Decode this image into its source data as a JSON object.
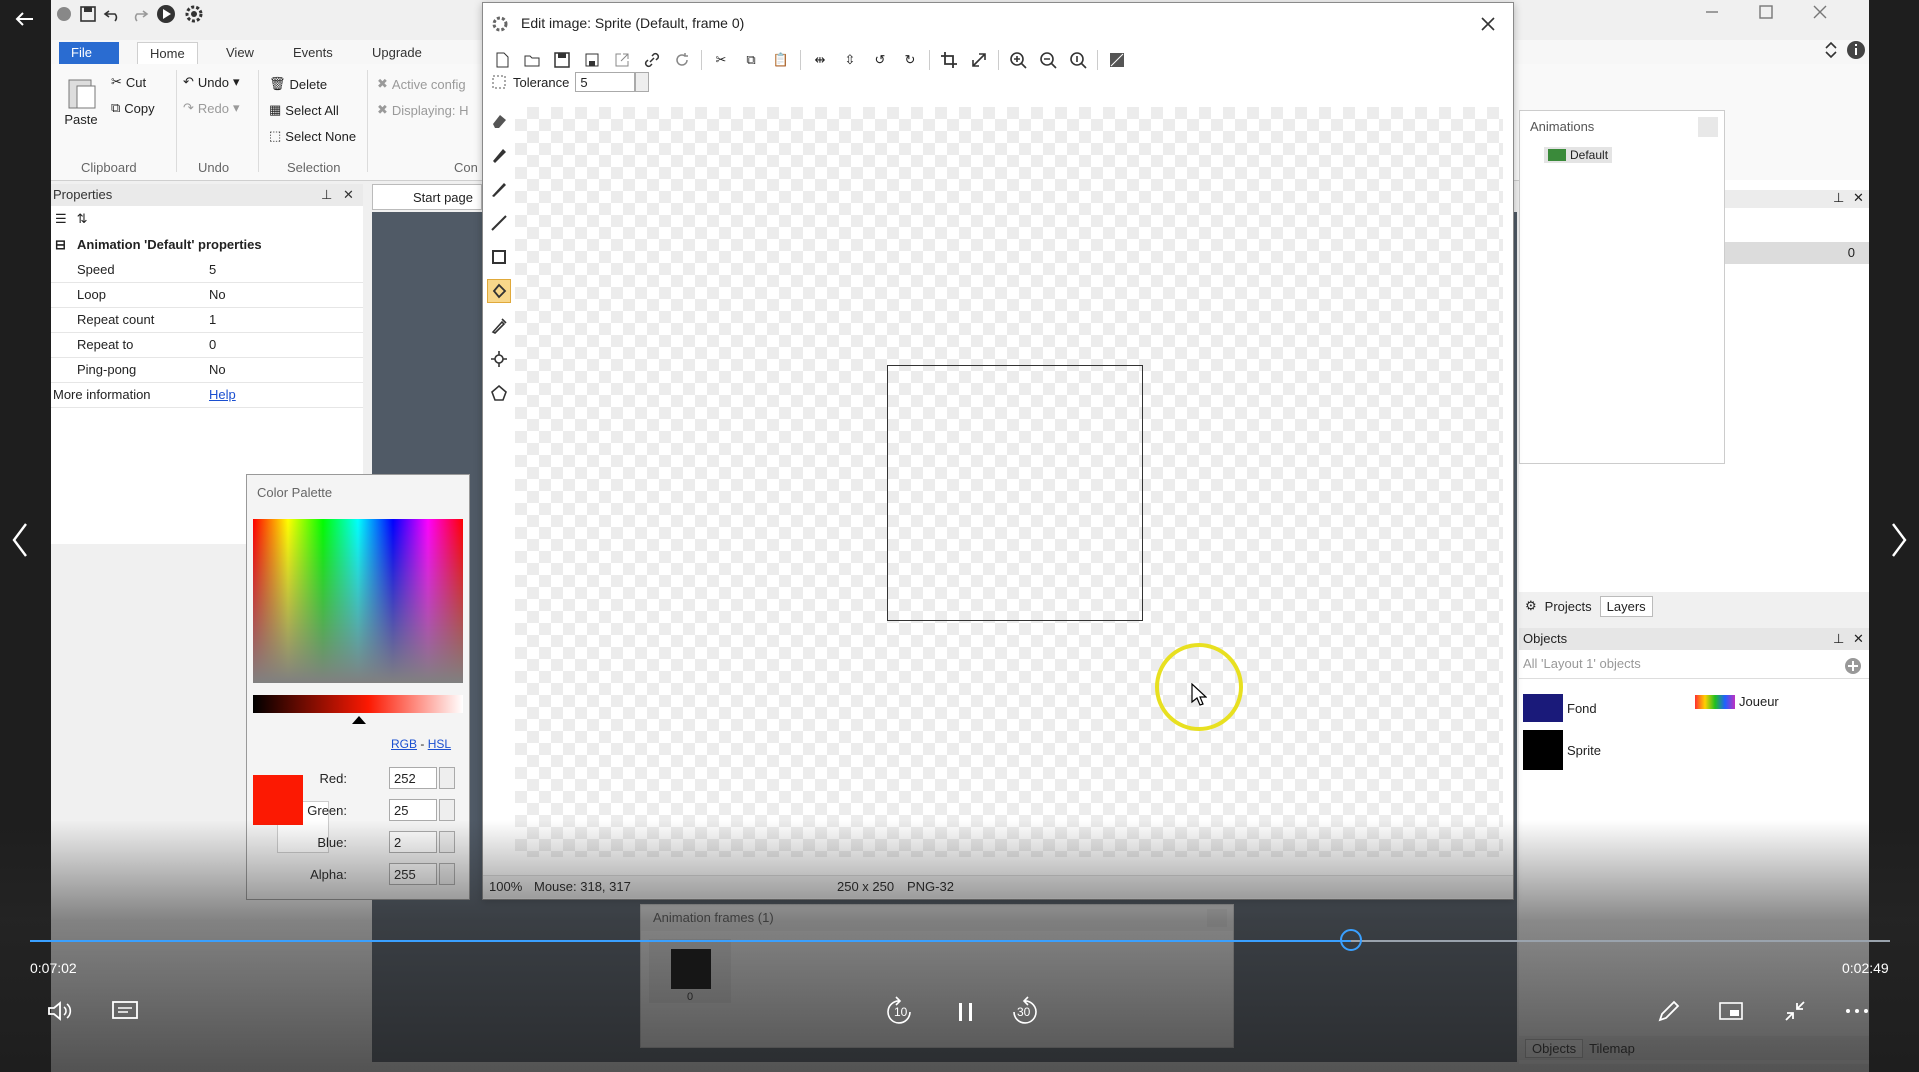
{
  "ribbon": {
    "tabs": [
      "File",
      "Home",
      "View",
      "Events",
      "Upgrade"
    ],
    "clipboard": {
      "paste": "Paste",
      "cut": "Cut",
      "copy": "Copy",
      "label": "Clipboard"
    },
    "undo": {
      "undo": "Undo",
      "redo": "Redo",
      "label": "Undo"
    },
    "selection": {
      "delete": "Delete",
      "select_all": "Select All",
      "select_none": "Select None",
      "label": "Selection"
    },
    "config": {
      "active": "Active config",
      "displaying": "Displaying: H",
      "label": "Con"
    }
  },
  "properties": {
    "title": "Properties",
    "section": "Animation 'Default' properties",
    "rows": [
      {
        "k": "Speed",
        "v": "5"
      },
      {
        "k": "Loop",
        "v": "No"
      },
      {
        "k": "Repeat count",
        "v": "1"
      },
      {
        "k": "Repeat to",
        "v": "0"
      },
      {
        "k": "Ping-pong",
        "v": "No"
      }
    ],
    "more_label": "More information",
    "more_link": "Help"
  },
  "center": {
    "start_tab": "Start page"
  },
  "dialog": {
    "title": "Edit image: Sprite (Default, frame 0)",
    "tolerance_label": "Tolerance",
    "tolerance_value": "5",
    "status_zoom": "100%",
    "status_mouse": "Mouse: 318, 317",
    "status_size": "250 x 250",
    "status_format": "PNG-32"
  },
  "palette": {
    "title": "Color Palette",
    "rgb": "RGB",
    "dash": "-",
    "hsl": "HSL",
    "fields": [
      {
        "label": "Red:",
        "value": "252"
      },
      {
        "label": "Green:",
        "value": "25"
      },
      {
        "label": "Blue:",
        "value": "2"
      },
      {
        "label": "Alpha:",
        "value": "255"
      }
    ],
    "current_color": "#fc1902"
  },
  "frames": {
    "title": "Animation frames (1)",
    "frame_index": "0"
  },
  "animations": {
    "title": "Animations",
    "item": "Default"
  },
  "right": {
    "value": "0",
    "tab_projects": "Projects",
    "tab_layers": "Layers"
  },
  "objects": {
    "title": "Objects",
    "search_placeholder": "All 'Layout 1' objects",
    "items": [
      "Fond",
      "Joueur",
      "Sprite"
    ],
    "tab_objects": "Objects",
    "tab_tilemap": "Tilemap"
  },
  "video": {
    "elapsed": "0:07:02",
    "remaining": "0:02:49",
    "progress": 0.71,
    "skip_back": "10",
    "skip_fwd": "30"
  },
  "colors": {
    "accent": "#2a6cd1",
    "cursor_ring": "#e8e020",
    "link": "#1a4fd0"
  }
}
